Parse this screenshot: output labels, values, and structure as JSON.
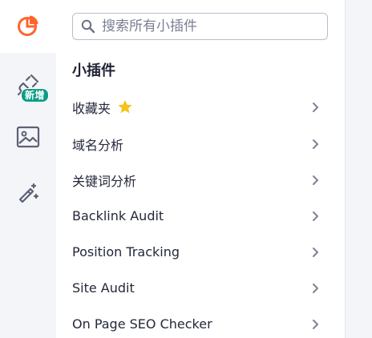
{
  "rail": {
    "logo_icon": "pie-chart-logo-icon",
    "new_badge": "新增",
    "accent": "#ff642d",
    "badge_color": "#0d9d86"
  },
  "search": {
    "placeholder": "搜索所有小插件",
    "value": ""
  },
  "section": {
    "title": "小插件"
  },
  "items": [
    {
      "label": "收藏夹",
      "icon": "star-icon"
    },
    {
      "label": "域名分析"
    },
    {
      "label": "关键词分析"
    },
    {
      "label": "Backlink Audit"
    },
    {
      "label": "Position Tracking"
    },
    {
      "label": "Site Audit"
    },
    {
      "label": "On Page SEO Checker"
    }
  ]
}
